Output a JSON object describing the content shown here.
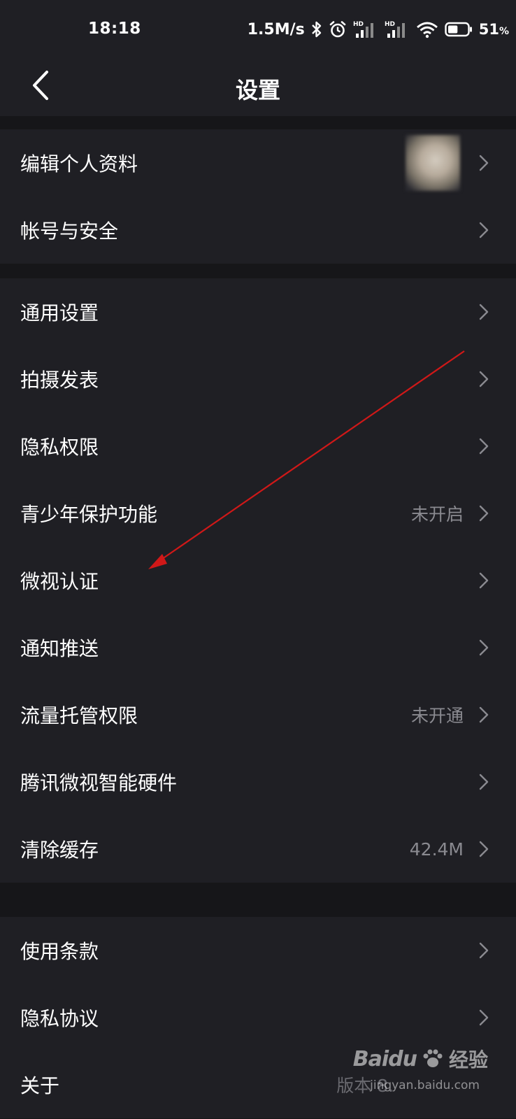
{
  "status_bar": {
    "time": "18:18",
    "net_speed": "1.5M/s",
    "battery_percent": "51",
    "battery_unit": "%",
    "hd_label": "HD",
    "battery_level": 0.51
  },
  "header": {
    "title": "设置"
  },
  "groups": [
    {
      "items": [
        {
          "label": "编辑个人资料",
          "value": ""
        },
        {
          "label": "帐号与安全",
          "value": ""
        }
      ]
    },
    {
      "items": [
        {
          "label": "通用设置",
          "value": ""
        },
        {
          "label": "拍摄发表",
          "value": ""
        },
        {
          "label": "隐私权限",
          "value": ""
        },
        {
          "label": "青少年保护功能",
          "value": "未开启"
        },
        {
          "label": "微视认证",
          "value": ""
        },
        {
          "label": "通知推送",
          "value": ""
        },
        {
          "label": "流量托管权限",
          "value": "未开通"
        },
        {
          "label": "腾讯微视智能硬件",
          "value": ""
        },
        {
          "label": "清除缓存",
          "value": "42.4M"
        }
      ]
    },
    {
      "items": [
        {
          "label": "使用条款",
          "value": ""
        },
        {
          "label": "隐私协议",
          "value": ""
        },
        {
          "label": "关于",
          "value": "版本 8."
        }
      ]
    }
  ],
  "watermark": {
    "brand": "Baidu",
    "suffix": "经验",
    "url": "jingyan.baidu.com"
  },
  "colors": {
    "background": "#161619",
    "card": "#1f1f24",
    "text": "#ffffff",
    "secondary_text": "#8a8a90",
    "annotation_arrow": "#d01818"
  }
}
